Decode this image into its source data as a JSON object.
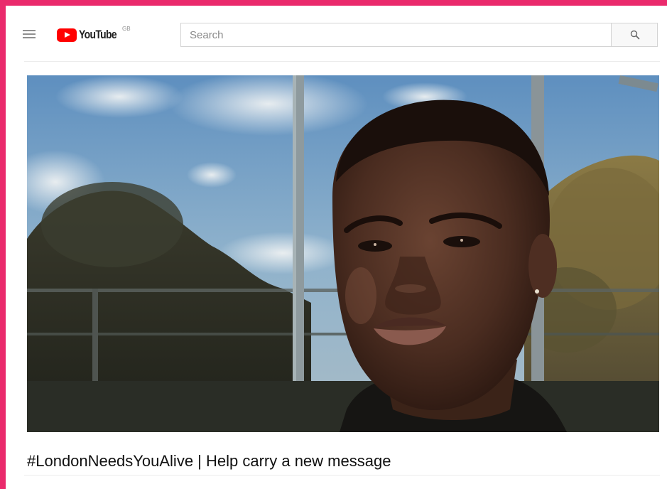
{
  "header": {
    "logo_text": "YouTube",
    "country_code": "GB",
    "menu_icon": "hamburger-menu-icon",
    "search": {
      "placeholder": "Search",
      "value": "",
      "button_icon": "search-icon"
    }
  },
  "video": {
    "title": "#LondonNeedsYouAlive | Help carry a new message"
  },
  "colors": {
    "page_border": "#ea2a6c",
    "brand_red": "#ff0000"
  }
}
